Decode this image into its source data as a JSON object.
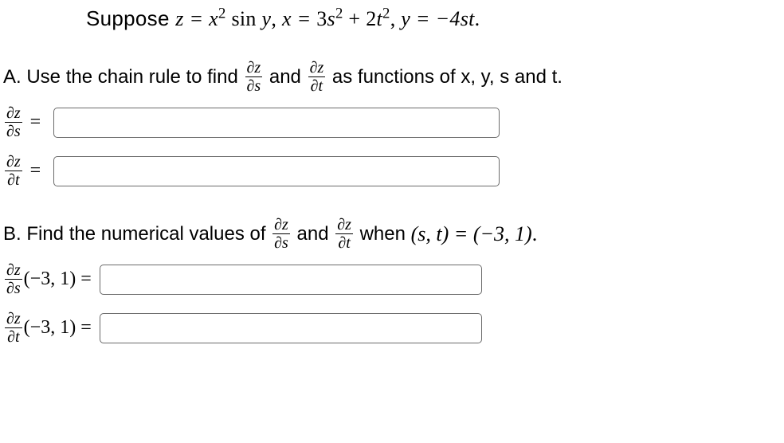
{
  "intro": {
    "prefix": "Suppose ",
    "eq_z_lhs": "z = ",
    "eq_z_rhs_a": "x",
    "eq_z_sup1": "2",
    "eq_z_sin": " sin ",
    "eq_z_y": "y",
    "sep1": ", ",
    "eq_x_lhs": "x = ",
    "eq_x_a": "3",
    "eq_x_s": "s",
    "eq_x_sup2": "2",
    "eq_x_plus": " + 2",
    "eq_x_t": "t",
    "eq_x_sup3": "2",
    "sep2": ", ",
    "eq_y": "y = −4st",
    "period": "."
  },
  "partA": {
    "lead": "A. Use the chain rule to find ",
    "and": " and ",
    "tail": " as functions of x, y, s and t.",
    "dzds_num": "∂z",
    "dzds_den": "∂s",
    "dzdt_num": "∂z",
    "dzdt_den": "∂t"
  },
  "labels": {
    "dzds_num": "∂z",
    "dzds_den": "∂s",
    "dzdt_num": "∂z",
    "dzdt_den": "∂t",
    "eq": " = "
  },
  "partB": {
    "lead": "B. Find the numerical values of ",
    "and": " and ",
    "when": " when ",
    "point": "(s, t) = (−3, 1)",
    "period": ".",
    "lhs_ds_point": "(−3, 1) = ",
    "lhs_dt_point": "(−3, 1) = "
  },
  "inputs": {
    "dzds": "",
    "dzdt": "",
    "dzds_val": "",
    "dzdt_val": ""
  }
}
